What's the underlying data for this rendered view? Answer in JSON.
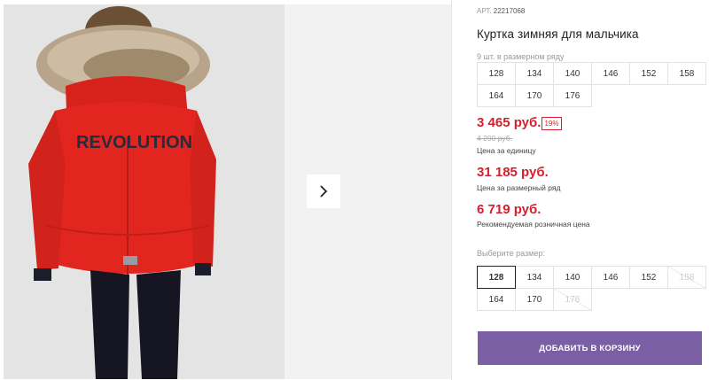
{
  "product": {
    "article_label": "АРТ.",
    "article_number": "22217068",
    "title": "Куртка зимняя для мальчика",
    "count_in_row": "9 шт. в размерном ряду",
    "print_text": "REVOLUTION"
  },
  "size_row": [
    "128",
    "134",
    "140",
    "146",
    "152",
    "158",
    "164",
    "170",
    "176"
  ],
  "prices": {
    "unit_price": "3 465 руб.",
    "discount": "19%",
    "old_price": "4 290 руб.",
    "unit_label": "Цена за единицу",
    "row_price": "31 185 руб.",
    "row_label": "Цена за размерный ряд",
    "retail_price": "6 719 руб.",
    "retail_label": "Рекомендуемая розничная цена"
  },
  "size_select": {
    "label": "Выберите размер:",
    "options": [
      {
        "size": "128",
        "state": "selected"
      },
      {
        "size": "134",
        "state": "available"
      },
      {
        "size": "140",
        "state": "available"
      },
      {
        "size": "146",
        "state": "available"
      },
      {
        "size": "152",
        "state": "available"
      },
      {
        "size": "158",
        "state": "disabled"
      },
      {
        "size": "164",
        "state": "available"
      },
      {
        "size": "170",
        "state": "available"
      },
      {
        "size": "176",
        "state": "disabled"
      }
    ]
  },
  "cart": {
    "add_label": "ДОБАВИТЬ В КОРЗИНУ"
  },
  "colors": {
    "price_red": "#d4202e",
    "button_purple": "#7b5fa5",
    "jacket_red": "#e2261f"
  },
  "icons": {
    "next": "chevron-right-icon"
  }
}
